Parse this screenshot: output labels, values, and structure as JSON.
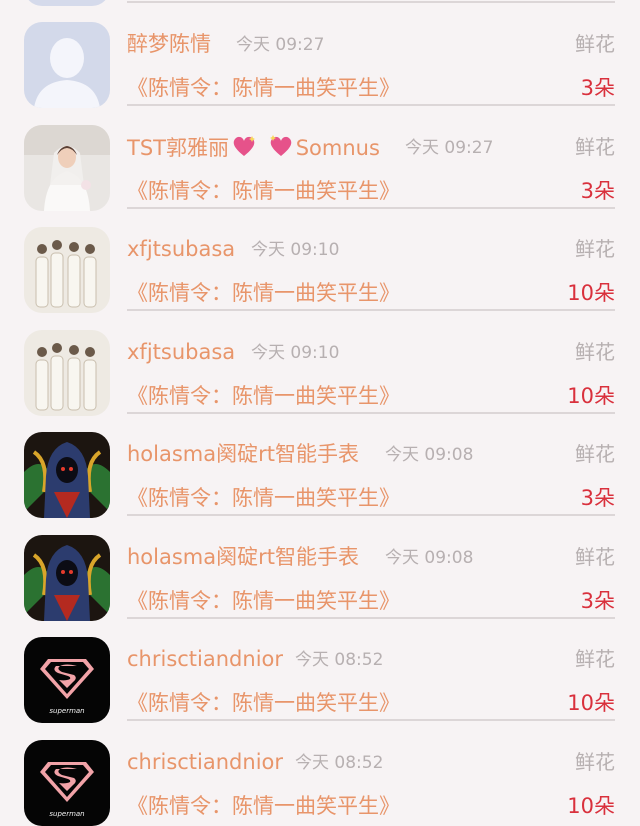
{
  "gift_list": [
    {
      "user": "醉梦陈情",
      "time": "今天 09:27",
      "gift_type": "鲜花",
      "song": "《陈情令：陈情一曲笑平生》",
      "count": "3朵",
      "avatar": "default-avatar-icon"
    },
    {
      "user_prefix": "TST郭雅丽",
      "user_suffix": "Somnus",
      "time": "今天 09:27",
      "gift_type": "鲜花",
      "song": "《陈情令：陈情一曲笑平生》",
      "count": "3朵",
      "avatar": "bride-photo"
    },
    {
      "user": "xfjtsubasa",
      "time": "今天 09:10",
      "gift_type": "鲜花",
      "song": "《陈情令：陈情一曲笑平生》",
      "count": "10朵",
      "avatar": "group-photo"
    },
    {
      "user": "xfjtsubasa",
      "time": "今天 09:10",
      "gift_type": "鲜花",
      "song": "《陈情令：陈情一曲笑平生》",
      "count": "10朵",
      "avatar": "group-photo"
    },
    {
      "user": "holasma阕碇rt智能手表",
      "time": "今天 09:08",
      "gift_type": "鲜花",
      "song": "《陈情令：陈情一曲笑平生》",
      "count": "3朵",
      "avatar": "hooded-figure-art"
    },
    {
      "user": "holasma阕碇rt智能手表",
      "time": "今天 09:08",
      "gift_type": "鲜花",
      "song": "《陈情令：陈情一曲笑平生》",
      "count": "3朵",
      "avatar": "hooded-figure-art"
    },
    {
      "user": "chrisctiandnior",
      "time": "今天 08:52",
      "gift_type": "鲜花",
      "song": "《陈情令：陈情一曲笑平生》",
      "count": "10朵",
      "avatar": "superman-logo"
    },
    {
      "user": "chrisctiandnior",
      "time": "今天 08:52",
      "gift_type": "鲜花",
      "song": "《陈情令：陈情一曲笑平生》",
      "count": "10朵",
      "avatar": "superman-logo"
    }
  ],
  "superman_text": "superman",
  "colors": {
    "name": "#e8956a",
    "muted": "#b7b0b1",
    "count": "#d9303c",
    "background": "#f7f3f4",
    "heart": "#e6528a"
  }
}
